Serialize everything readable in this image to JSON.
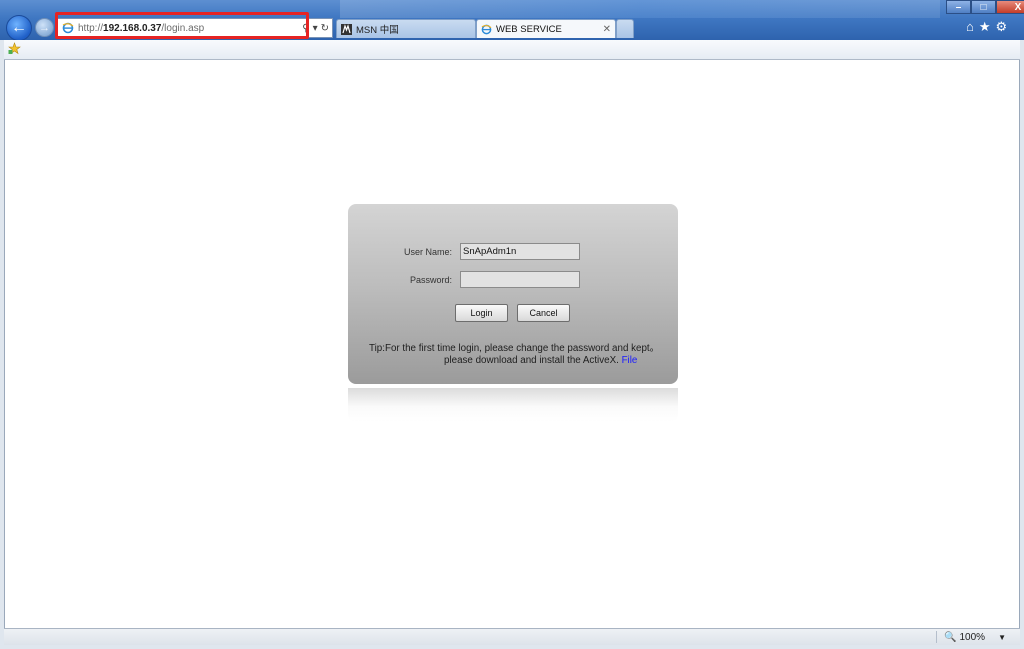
{
  "browser": {
    "address": {
      "scheme": "http://",
      "host": "192.168.0.37",
      "path": "/login.asp"
    },
    "tabs": [
      {
        "label": "MSN 中国",
        "active": false
      },
      {
        "label": "WEB SERVICE",
        "active": true
      }
    ],
    "zoom": "100%",
    "colors": {
      "chrome": "#3f77c2",
      "highlight": "#e52424"
    }
  },
  "login": {
    "username_label": "User Name:",
    "username_value": "SnApAdm1n",
    "password_label": "Password:",
    "password_value": "",
    "login_button": "Login",
    "cancel_button": "Cancel",
    "tip_line1": "Tip:For the first time login, please change the password and kept。",
    "tip_line2": "please download and install the ActiveX.",
    "file_link": "File"
  }
}
